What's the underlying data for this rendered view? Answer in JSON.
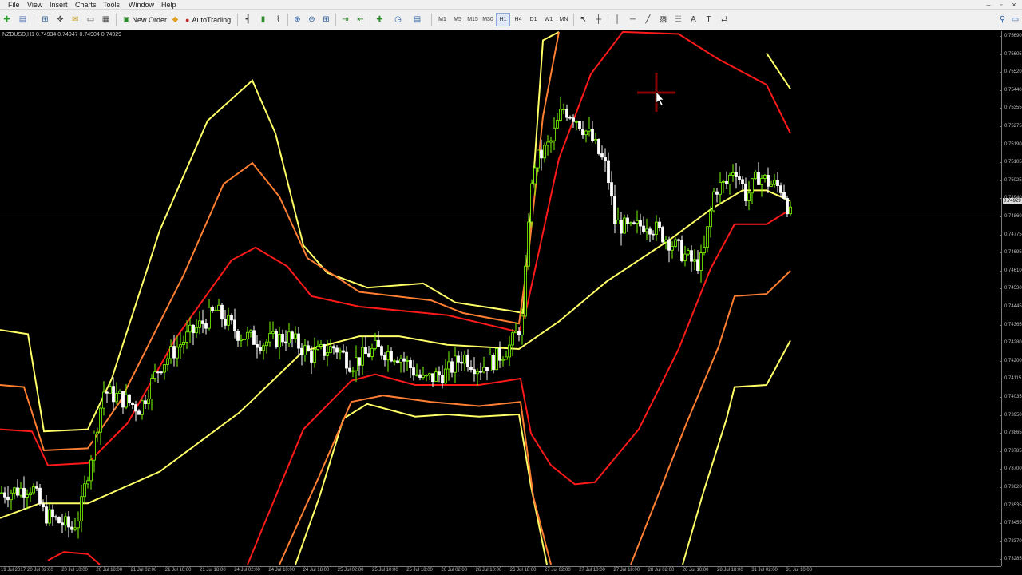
{
  "menu": {
    "items": [
      "File",
      "View",
      "Insert",
      "Charts",
      "Tools",
      "Window",
      "Help"
    ]
  },
  "toolbar": {
    "new_order_label": "New Order",
    "autotrading_label": "AutoTrading",
    "timeframes": [
      "M1",
      "M5",
      "M15",
      "M30",
      "H1",
      "H4",
      "D1",
      "W1",
      "MN"
    ],
    "active_timeframe": "H1",
    "font_sample_label": "A"
  },
  "chart": {
    "info_text": "NZDUSD,H1  0.74934 0.74947 0.74904 0.74929",
    "current_price_label": "0.74929",
    "colors": {
      "background": "#000000",
      "bull_candle": "#7CFC00",
      "bear_candle": "#ffffff",
      "band_inner": "#ff1a1a",
      "band_middle": "#ff7f32",
      "band_outer": "#ffff66",
      "center_line": "#ffff66",
      "crosshair": "#8b0000",
      "bid_line": "#a0a0a0"
    }
  },
  "chart_data": {
    "type": "candlestick",
    "symbol": "NZDUSD",
    "timeframe": "H1",
    "ylim": [
      0.7328,
      0.7569
    ],
    "price_labels": [
      "0.75690",
      "0.75605",
      "0.75520",
      "0.75440",
      "0.75355",
      "0.75275",
      "0.75190",
      "0.75105",
      "0.75025",
      "0.74940",
      "0.74860",
      "0.74775",
      "0.74695",
      "0.74610",
      "0.74530",
      "0.74445",
      "0.74365",
      "0.74280",
      "0.74200",
      "0.74115",
      "0.74035",
      "0.73950",
      "0.73865",
      "0.73785",
      "0.73700",
      "0.73620",
      "0.73535",
      "0.73455",
      "0.73370",
      "0.73285"
    ],
    "time_labels": [
      "19 Jul 2017",
      "20 Jul 02:00",
      "20 Jul 10:00",
      "20 Jul 18:00",
      "21 Jul 02:00",
      "21 Jul 10:00",
      "21 Jul 18:00",
      "24 Jul 02:00",
      "24 Jul 10:00",
      "24 Jul 18:00",
      "25 Jul 02:00",
      "25 Jul 10:00",
      "25 Jul 18:00",
      "26 Jul 02:00",
      "26 Jul 10:00",
      "26 Jul 18:00",
      "27 Jul 02:00",
      "27 Jul 10:00",
      "27 Jul 18:00",
      "28 Jul 02:00",
      "28 Jul 10:00",
      "28 Jul 18:00",
      "31 Jul 02:00",
      "31 Jul 10:00"
    ],
    "bid_line_price": 0.74929,
    "center": [
      [
        0,
        0.735
      ],
      [
        50,
        0.7357
      ],
      [
        110,
        0.7357
      ],
      [
        200,
        0.7372
      ],
      [
        300,
        0.74
      ],
      [
        380,
        0.7429
      ],
      [
        450,
        0.7436
      ],
      [
        500,
        0.7436
      ],
      [
        560,
        0.7432
      ],
      [
        650,
        0.743
      ],
      [
        700,
        0.7443
      ],
      [
        760,
        0.7462
      ],
      [
        840,
        0.7482
      ],
      [
        890,
        0.7496
      ],
      [
        930,
        0.7505
      ],
      [
        960,
        0.7505
      ],
      [
        990,
        0.75
      ]
    ],
    "bands": [
      {
        "name": "outer_upper",
        "color_key": "band_outer",
        "points": [
          [
            0,
            0.7439
          ],
          [
            35,
            0.7437
          ],
          [
            55,
            0.7391
          ],
          [
            110,
            0.7392
          ],
          [
            140,
            0.7416
          ],
          [
            200,
            0.7486
          ],
          [
            260,
            0.7538
          ],
          [
            316,
            0.7557
          ],
          [
            345,
            0.7532
          ],
          [
            380,
            0.7479
          ],
          [
            410,
            0.7466
          ],
          [
            460,
            0.7459
          ],
          [
            530,
            0.7461
          ],
          [
            570,
            0.7452
          ],
          [
            640,
            0.7448
          ],
          [
            655,
            0.7447
          ],
          [
            668,
            0.751
          ],
          [
            680,
            0.7576
          ],
          [
            700,
            0.758
          ]
        ]
      },
      {
        "name": "middle_upper",
        "color_key": "band_middle",
        "points": [
          [
            0,
            0.7413
          ],
          [
            30,
            0.7412
          ],
          [
            55,
            0.7382
          ],
          [
            110,
            0.7383
          ],
          [
            150,
            0.7405
          ],
          [
            230,
            0.7465
          ],
          [
            280,
            0.7508
          ],
          [
            316,
            0.7518
          ],
          [
            350,
            0.7502
          ],
          [
            385,
            0.7473
          ],
          [
            450,
            0.7457
          ],
          [
            540,
            0.7453
          ],
          [
            580,
            0.7447
          ],
          [
            650,
            0.7442
          ],
          [
            662,
            0.7475
          ],
          [
            680,
            0.754
          ],
          [
            700,
            0.758
          ]
        ]
      },
      {
        "name": "inner_upper",
        "color_key": "band_red",
        "points": [
          [
            0,
            0.7392
          ],
          [
            40,
            0.7391
          ],
          [
            60,
            0.7375
          ],
          [
            110,
            0.7376
          ],
          [
            160,
            0.7395
          ],
          [
            220,
            0.7435
          ],
          [
            290,
            0.7472
          ],
          [
            320,
            0.7478
          ],
          [
            360,
            0.7469
          ],
          [
            390,
            0.7455
          ],
          [
            450,
            0.745
          ],
          [
            560,
            0.7446
          ],
          [
            650,
            0.7438
          ],
          [
            660,
            0.745
          ],
          [
            700,
            0.752
          ],
          [
            740,
            0.756
          ],
          [
            780,
            0.758
          ],
          [
            850,
            0.7579
          ],
          [
            900,
            0.7567
          ],
          [
            960,
            0.7555
          ],
          [
            990,
            0.7532
          ]
        ]
      },
      {
        "name": "outer_lower",
        "color_key": "band_outer",
        "points": [
          [
            370,
            0.7328
          ],
          [
            400,
            0.736
          ],
          [
            430,
            0.7397
          ],
          [
            460,
            0.7404
          ],
          [
            520,
            0.7398
          ],
          [
            560,
            0.7399
          ],
          [
            600,
            0.7398
          ],
          [
            650,
            0.7399
          ],
          [
            665,
            0.7365
          ],
          [
            685,
            0.7328
          ]
        ]
      },
      {
        "name": "middle_lower",
        "color_key": "band_middle",
        "points": [
          [
            350,
            0.7328
          ],
          [
            400,
            0.737
          ],
          [
            440,
            0.7405
          ],
          [
            480,
            0.7408
          ],
          [
            540,
            0.7405
          ],
          [
            600,
            0.7403
          ],
          [
            652,
            0.7405
          ],
          [
            668,
            0.736
          ],
          [
            690,
            0.7328
          ]
        ]
      },
      {
        "name": "inner_lower",
        "color_key": "band_red",
        "points": [
          [
            310,
            0.7328
          ],
          [
            380,
            0.7392
          ],
          [
            440,
            0.7415
          ],
          [
            470,
            0.7418
          ],
          [
            520,
            0.7413
          ],
          [
            600,
            0.7413
          ],
          [
            652,
            0.7416
          ],
          [
            665,
            0.739
          ],
          [
            690,
            0.7375
          ],
          [
            720,
            0.7366
          ],
          [
            745,
            0.7367
          ],
          [
            800,
            0.7392
          ],
          [
            850,
            0.743
          ],
          [
            890,
            0.7468
          ],
          [
            920,
            0.7489
          ],
          [
            960,
            0.7489
          ],
          [
            990,
            0.7496
          ]
        ]
      },
      {
        "name": "middle_lower_2",
        "color_key": "band_middle",
        "points": [
          [
            790,
            0.7328
          ],
          [
            860,
            0.7395
          ],
          [
            900,
            0.7431
          ],
          [
            920,
            0.7455
          ],
          [
            960,
            0.7456
          ],
          [
            990,
            0.7467
          ]
        ]
      },
      {
        "name": "outer_lower_2",
        "color_key": "band_outer",
        "points": [
          [
            855,
            0.7328
          ],
          [
            880,
            0.7361
          ],
          [
            910,
            0.7397
          ],
          [
            920,
            0.7412
          ],
          [
            960,
            0.7413
          ],
          [
            990,
            0.7434
          ]
        ]
      },
      {
        "name": "inner_lower_left",
        "color_key": "band_red",
        "points": [
          [
            60,
            0.733
          ],
          [
            80,
            0.7334
          ],
          [
            110,
            0.7333
          ],
          [
            125,
            0.7328
          ]
        ]
      },
      {
        "name": "outer_upper_2",
        "color_key": "band_outer",
        "points": [
          [
            960,
            0.757
          ],
          [
            990,
            0.7553
          ]
        ]
      }
    ],
    "candle_path": [
      [
        0,
        0.7362
      ],
      [
        20,
        0.7363
      ],
      [
        40,
        0.7365
      ],
      [
        55,
        0.7352
      ],
      [
        70,
        0.7349
      ],
      [
        90,
        0.7345
      ],
      [
        100,
        0.7352
      ],
      [
        115,
        0.7382
      ],
      [
        130,
        0.741
      ],
      [
        150,
        0.7407
      ],
      [
        175,
        0.7402
      ],
      [
        200,
        0.7422
      ],
      [
        230,
        0.7434
      ],
      [
        250,
        0.7441
      ],
      [
        270,
        0.7448
      ],
      [
        300,
        0.7437
      ],
      [
        330,
        0.7433
      ],
      [
        360,
        0.7436
      ],
      [
        390,
        0.7427
      ],
      [
        420,
        0.7431
      ],
      [
        440,
        0.7423
      ],
      [
        470,
        0.743
      ],
      [
        500,
        0.7427
      ],
      [
        530,
        0.7415
      ],
      [
        560,
        0.7419
      ],
      [
        580,
        0.7427
      ],
      [
        600,
        0.7421
      ],
      [
        620,
        0.7425
      ],
      [
        640,
        0.7432
      ],
      [
        655,
        0.7444
      ],
      [
        662,
        0.7493
      ],
      [
        670,
        0.7518
      ],
      [
        690,
        0.7528
      ],
      [
        705,
        0.7544
      ],
      [
        720,
        0.754
      ],
      [
        740,
        0.753
      ],
      [
        760,
        0.7515
      ],
      [
        770,
        0.749
      ],
      [
        790,
        0.7486
      ],
      [
        810,
        0.749
      ],
      [
        830,
        0.7484
      ],
      [
        850,
        0.7477
      ],
      [
        870,
        0.747
      ],
      [
        880,
        0.7472
      ],
      [
        895,
        0.7506
      ],
      [
        910,
        0.7508
      ],
      [
        920,
        0.7517
      ],
      [
        935,
        0.7502
      ],
      [
        950,
        0.7512
      ],
      [
        965,
        0.7508
      ],
      [
        980,
        0.7506
      ],
      [
        990,
        0.7493
      ]
    ]
  }
}
